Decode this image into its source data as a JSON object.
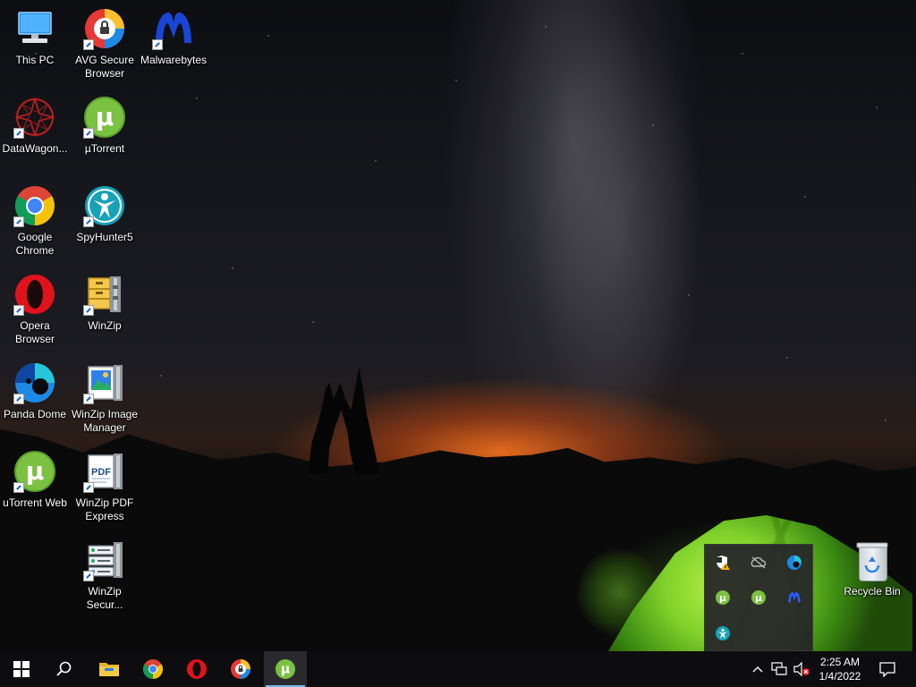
{
  "desktop": {
    "icons": [
      {
        "label": "This PC",
        "icon": "computer-icon"
      },
      {
        "label": "AVG Secure Browser",
        "icon": "avg-browser-icon"
      },
      {
        "label": "Malwarebytes",
        "icon": "malwarebytes-icon"
      },
      {
        "label": "DataWagon...",
        "icon": "datawagon-icon"
      },
      {
        "label": "µTorrent",
        "icon": "utorrent-icon"
      },
      {
        "label": "Google Chrome",
        "icon": "chrome-icon"
      },
      {
        "label": "SpyHunter5",
        "icon": "spyhunter-icon"
      },
      {
        "label": "Opera Browser",
        "icon": "opera-icon"
      },
      {
        "label": "WinZip",
        "icon": "winzip-icon"
      },
      {
        "label": "Panda Dome",
        "icon": "panda-dome-icon"
      },
      {
        "label": "WinZip Image Manager",
        "icon": "winzip-image-manager-icon"
      },
      {
        "label": "uTorrent Web",
        "icon": "utorrent-web-icon"
      },
      {
        "label": "WinZip PDF Express",
        "icon": "winzip-pdf-icon"
      },
      {
        "label": "WinZip Secur...",
        "icon": "winzip-secure-icon"
      },
      {
        "label": "Recycle Bin",
        "icon": "recycle-bin-icon"
      }
    ]
  },
  "taskbar": {
    "pinned": [
      "start-button",
      "search-button",
      "file-explorer",
      "google-chrome",
      "opera",
      "avg-secure-browser",
      "utorrent"
    ],
    "active": "utorrent"
  },
  "tray_overflow": {
    "icons": [
      "windows-security-warning-icon",
      "onedrive-offline-icon",
      "panda-dome-tray-icon",
      "utorrent-web-tray-icon",
      "utorrent-tray-icon",
      "malwarebytes-tray-icon",
      "spyhunter-tray-icon"
    ]
  },
  "clock": {
    "time": "2:25 AM",
    "date": "1/4/2022"
  },
  "colors": {
    "taskbar": "#0d0d0f",
    "accent": "#76b9ed",
    "utorrent_green": "#7bc142"
  }
}
